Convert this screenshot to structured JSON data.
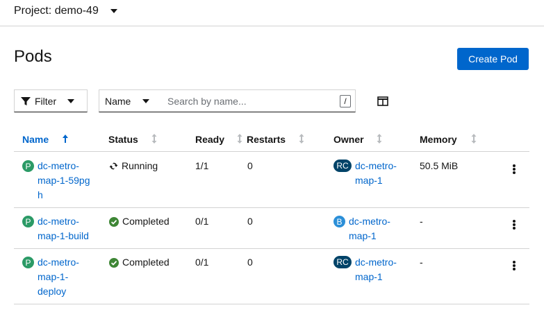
{
  "project": {
    "label": "Project: demo-49"
  },
  "page": {
    "title": "Pods",
    "create_button": "Create Pod"
  },
  "toolbar": {
    "filter_label": "Filter",
    "name_selector": "Name",
    "search_placeholder": "Search by name...",
    "search_hint_key": "/",
    "columns_icon": "column-management-icon"
  },
  "table": {
    "headers": [
      "Name",
      "Status",
      "Ready",
      "Restarts",
      "Owner",
      "Memory"
    ],
    "sorted_column": "Name",
    "rows": [
      {
        "kind_badge": "P",
        "name": "dc-metro-\nmap-1-59pg\nh",
        "status": "Running",
        "status_icon": "sync-icon",
        "ready": "1/1",
        "restarts": "0",
        "owner_badge": "RC",
        "owner": "dc-metro-\nmap-1",
        "memory": "50.5 MiB"
      },
      {
        "kind_badge": "P",
        "name": "dc-metro-\nmap-1-build",
        "status": "Completed",
        "status_icon": "check-circle-icon",
        "ready": "0/1",
        "restarts": "0",
        "owner_badge": "B",
        "owner": "dc-metro-\nmap-1",
        "memory": "-"
      },
      {
        "kind_badge": "P",
        "name": "dc-metro-\nmap-1-\ndeploy",
        "status": "Completed",
        "status_icon": "check-circle-icon",
        "ready": "0/1",
        "restarts": "0",
        "owner_badge": "RC",
        "owner": "dc-metro-\nmap-1",
        "memory": "-"
      }
    ]
  },
  "colors": {
    "primary": "#0066cc",
    "success": "#3e8635",
    "pod_badge": "#2b9a66",
    "rc_badge": "#004368",
    "build_badge": "#2b8fd8"
  }
}
